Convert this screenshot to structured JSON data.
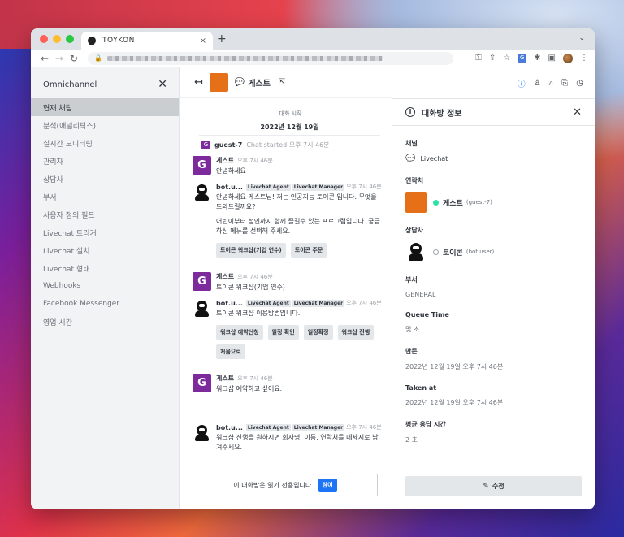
{
  "browser": {
    "tab_title": "TOYKON",
    "tab_close": "×",
    "new_tab": "+",
    "tab_menu": "⌄"
  },
  "sidebar": {
    "title": "Omnichannel",
    "close": "✕",
    "items": [
      {
        "label": "현재 채팅",
        "active": true
      },
      {
        "label": "분석(애널리틱스)"
      },
      {
        "label": "실시간 모니터링"
      },
      {
        "label": "관리자"
      },
      {
        "label": "상담사"
      },
      {
        "label": "부서"
      },
      {
        "label": "사용자 정의 필드"
      },
      {
        "label": "Livechat 트리거"
      },
      {
        "label": "Livechat 설치"
      },
      {
        "label": "Livechat 형태"
      },
      {
        "label": "Webhooks"
      },
      {
        "label": "Facebook Messenger"
      },
      {
        "label": "영업 시간"
      }
    ]
  },
  "room": {
    "name": "게스트",
    "avatar_color": "#e57017"
  },
  "chat": {
    "start_label": "대화 시작",
    "date": "2022년 12월 19일",
    "system": {
      "avatar": "G",
      "name": "guest-7",
      "text": "Chat started",
      "time": "오후 7시 46분"
    },
    "messages": [
      {
        "type": "guest",
        "avatar": "G",
        "name": "게스트",
        "time": "오후 7시 46분",
        "texts": [
          "안녕하세요"
        ]
      },
      {
        "type": "bot",
        "name": "bot.u...",
        "tag1": "Livechat Agent",
        "tag2": "Livechat Manager",
        "time": "오후 7시 46분",
        "texts": [
          "안녕하세요 게스트님! 저는 인공지능 토이콘 입니다. 무엇을 도와드릴까요?",
          "어린이부터 성인까지 함께 즐길수 있는 프로그램입니다. 궁금하신 메뉴를 선택해 주세요."
        ],
        "actions": [
          "토이콘 워크샵(기업 연수)",
          "토이콘 주문"
        ]
      },
      {
        "type": "guest",
        "avatar": "G",
        "name": "게스트",
        "time": "오후 7시 46분",
        "texts": [
          "토이콘 워크샵(기업 연수)"
        ]
      },
      {
        "type": "bot",
        "name": "bot.u...",
        "tag1": "Livechat Agent",
        "tag2": "Livechat Manager",
        "time": "오후 7시 46분",
        "texts": [
          "토이콘 워크샵 이용방법입니다."
        ],
        "actions": [
          "워크샵 예약신청",
          "일정 확인",
          "일정확정",
          "워크샵 진행",
          "처음으로"
        ]
      },
      {
        "type": "guest",
        "avatar": "G",
        "name": "게스트",
        "time": "오후 7시 46분",
        "texts": [
          "워크샵 예약하고 싶어요."
        ]
      },
      {
        "type": "bot",
        "name": "bot.u...",
        "tag1": "Livechat Agent",
        "tag2": "Livechat Manager",
        "time": "오후 7시 46분",
        "texts": [
          "워크샵 진행을 원하시면 회사명, 이름, 연락처를 메세지로 남겨주세요."
        ]
      }
    ],
    "readonly_text": "이 대화방은 읽기 전용입니다.",
    "join_label": "참여"
  },
  "info": {
    "title": "대화방 정보",
    "channel_label": "채널",
    "channel_value": "Livechat",
    "contact_label": "연락처",
    "contact_name": "게스트",
    "contact_user": "(guest-7)",
    "agent_label": "상담사",
    "agent_name": "토이콘",
    "agent_user": "(bot.user)",
    "dept_label": "부서",
    "dept_value": "GENERAL",
    "queue_label": "Queue Time",
    "queue_value": "몇 초",
    "created_label": "만든",
    "created_value": "2022년 12월 19일 오후 7시 46분",
    "taken_label": "Taken at",
    "taken_value": "2022년 12월 19일 오후 7시 46분",
    "avg_label": "평균 응답 시간",
    "avg_value": "2 초",
    "edit_label": "수정"
  }
}
